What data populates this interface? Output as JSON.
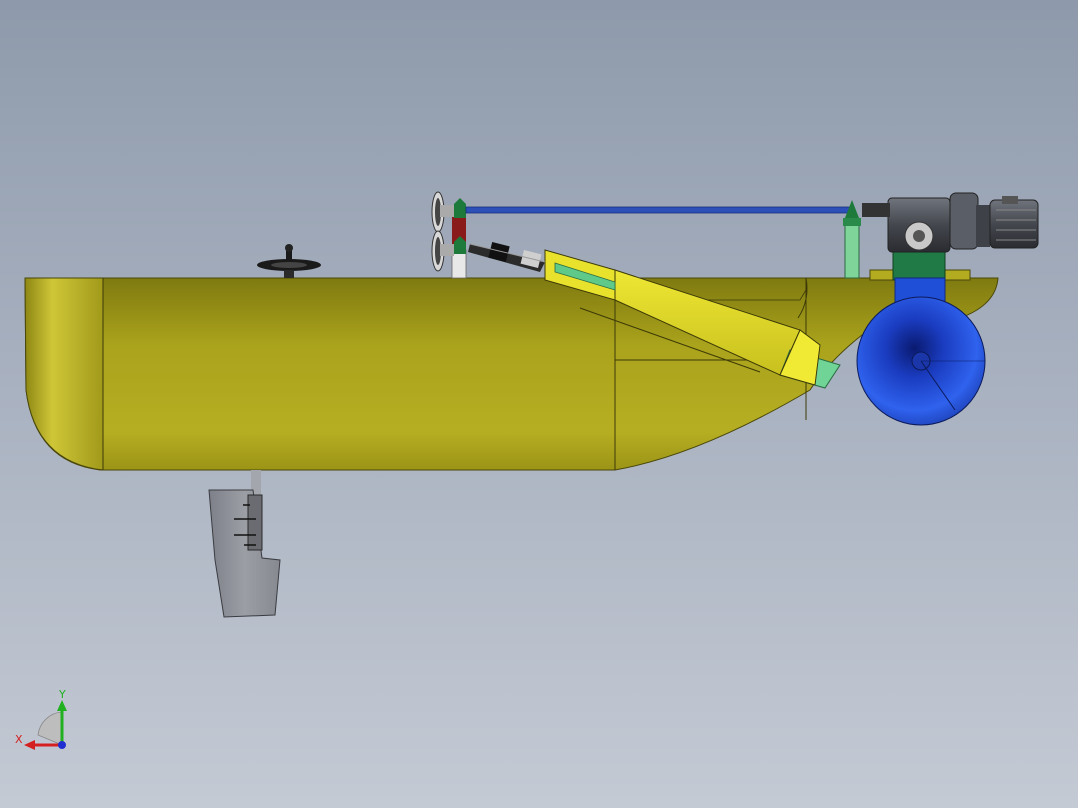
{
  "viewport": {
    "background_top": "#8e9aab",
    "background_bottom": "#c4cad4"
  },
  "model": {
    "hull_color": "#b0a81e",
    "hull_dark": "#8a8412",
    "wheel_color": "#1f4fd6",
    "shaft_color": "#2d4fb8",
    "chute_color": "#e6df2a",
    "pipe_color": "#5fc98a",
    "motor_color": "#5a5e66",
    "rudder_color": "#8d8f97"
  },
  "triad": {
    "x_label": "X",
    "y_label": "Y",
    "x_color": "#d42020",
    "y_color": "#20b020",
    "z_color": "#2030d0"
  }
}
